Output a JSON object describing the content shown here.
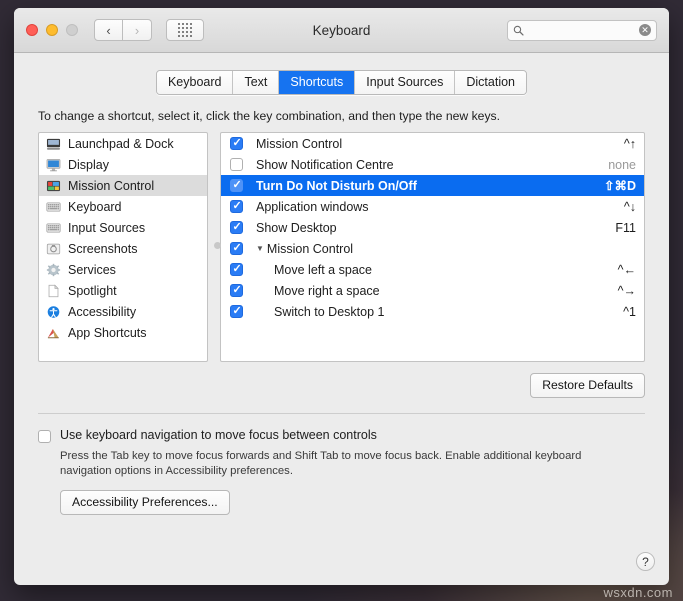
{
  "window": {
    "title": "Keyboard",
    "traffic_lights": [
      "close",
      "minimize",
      "zoom"
    ],
    "nav_back": "‹",
    "nav_forward": "›",
    "grid_icon": "grid-view-icon",
    "search": {
      "value": "",
      "placeholder": ""
    }
  },
  "tabs": [
    {
      "label": "Keyboard",
      "active": false
    },
    {
      "label": "Text",
      "active": false
    },
    {
      "label": "Shortcuts",
      "active": true
    },
    {
      "label": "Input Sources",
      "active": false
    },
    {
      "label": "Dictation",
      "active": false
    }
  ],
  "hint": "To change a shortcut, select it, click the key combination, and then type the new keys.",
  "sidebar": {
    "items": [
      {
        "label": "Launchpad & Dock",
        "icon": "launchpad-dock-icon",
        "selected": false
      },
      {
        "label": "Display",
        "icon": "display-icon",
        "selected": false
      },
      {
        "label": "Mission Control",
        "icon": "mission-control-icon",
        "selected": true
      },
      {
        "label": "Keyboard",
        "icon": "keyboard-icon",
        "selected": false
      },
      {
        "label": "Input Sources",
        "icon": "input-sources-icon",
        "selected": false
      },
      {
        "label": "Screenshots",
        "icon": "screenshots-icon",
        "selected": false
      },
      {
        "label": "Services",
        "icon": "services-gear-icon",
        "selected": false
      },
      {
        "label": "Spotlight",
        "icon": "spotlight-document-icon",
        "selected": false
      },
      {
        "label": "Accessibility",
        "icon": "accessibility-icon",
        "selected": false
      },
      {
        "label": "App Shortcuts",
        "icon": "app-shortcuts-icon",
        "selected": false
      }
    ]
  },
  "shortcuts": [
    {
      "label": "Mission Control",
      "key": "^↑",
      "checked": true,
      "selected": false,
      "level": "top",
      "group": false
    },
    {
      "label": "Show Notification Centre",
      "key": "none",
      "checked": false,
      "selected": false,
      "level": "top",
      "group": false
    },
    {
      "label": "Turn Do Not Disturb On/Off",
      "key": "⇧⌘D",
      "checked": true,
      "selected": true,
      "level": "top",
      "group": false
    },
    {
      "label": "Application windows",
      "key": "^↓",
      "checked": true,
      "selected": false,
      "level": "top",
      "group": false
    },
    {
      "label": "Show Desktop",
      "key": "F11",
      "checked": true,
      "selected": false,
      "level": "top",
      "group": false
    },
    {
      "label": "Mission Control",
      "key": "",
      "checked": true,
      "selected": false,
      "level": "group",
      "group": true
    },
    {
      "label": "Move left a space",
      "key": "^←",
      "checked": true,
      "selected": false,
      "level": "child",
      "group": false
    },
    {
      "label": "Move right a space",
      "key": "^→",
      "checked": true,
      "selected": false,
      "level": "child",
      "group": false
    },
    {
      "label": "Switch to Desktop 1",
      "key": "^1",
      "checked": true,
      "selected": false,
      "level": "child",
      "group": false
    }
  ],
  "buttons": {
    "restore_defaults": "Restore Defaults",
    "accessibility_preferences": "Accessibility Preferences...",
    "help": "?"
  },
  "keyboard_navigation": {
    "checkbox_label": "Use keyboard navigation to move focus between controls",
    "checked": false,
    "description": "Press the Tab key to move focus forwards and Shift Tab to move focus back. Enable additional keyboard navigation options in Accessibility preferences."
  },
  "watermark": "wsxdn.com",
  "colors": {
    "accent": "#0a6cf0",
    "tab_active": "#1673f0",
    "checkbox": "#2a7cf5",
    "sidebar_selected": "#dcdcdc"
  }
}
